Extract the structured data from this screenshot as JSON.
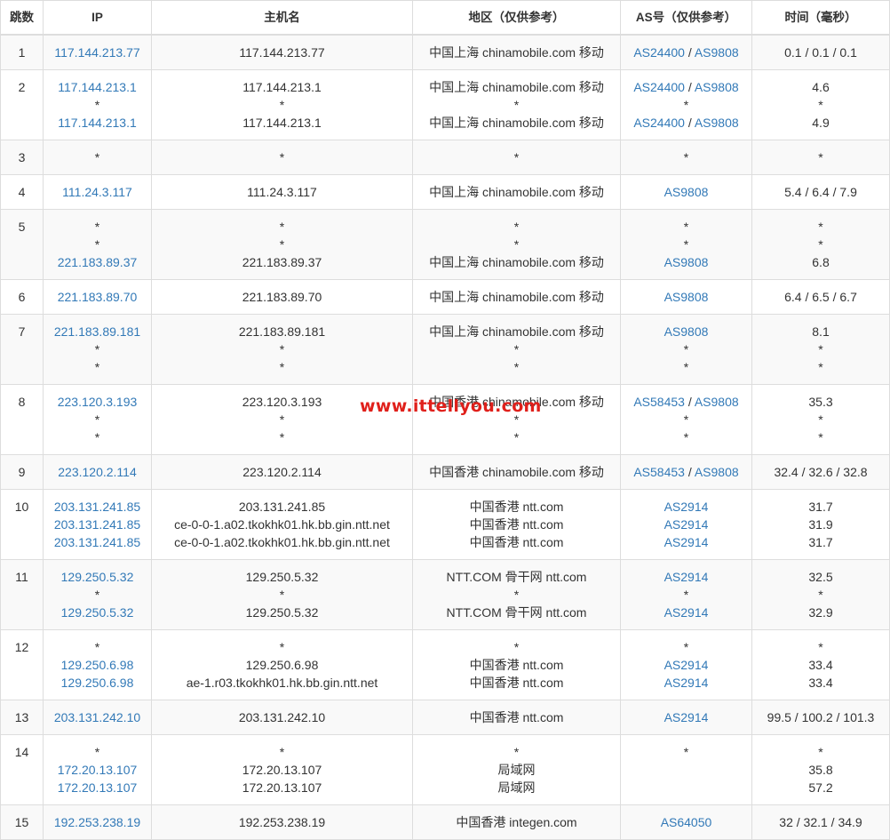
{
  "headers": [
    "跳数",
    "IP",
    "主机名",
    "地区（仅供参考）",
    "AS号（仅供参考）",
    "时间（毫秒）"
  ],
  "watermark": "www.ittellyou.com",
  "rows": [
    {
      "hop": "1",
      "ip": [
        "117.144.213.77"
      ],
      "host": [
        "117.144.213.77"
      ],
      "region": [
        "中国上海 chinamobile.com 移动"
      ],
      "as": [
        [
          "AS24400",
          "AS9808"
        ]
      ],
      "time": [
        "0.1 / 0.1 / 0.1"
      ]
    },
    {
      "hop": "2",
      "ip": [
        "117.144.213.1",
        "*",
        "117.144.213.1"
      ],
      "host": [
        "117.144.213.1",
        "*",
        "117.144.213.1"
      ],
      "region": [
        "中国上海 chinamobile.com 移动",
        "*",
        "中国上海 chinamobile.com 移动"
      ],
      "as": [
        [
          "AS24400",
          "AS9808"
        ],
        [
          "*"
        ],
        [
          "AS24400",
          "AS9808"
        ]
      ],
      "time": [
        "4.6",
        "*",
        "4.9"
      ]
    },
    {
      "hop": "3",
      "ip": [
        "*"
      ],
      "host": [
        "*"
      ],
      "region": [
        "*"
      ],
      "as": [
        [
          "*"
        ]
      ],
      "time": [
        "*"
      ]
    },
    {
      "hop": "4",
      "ip": [
        "111.24.3.117"
      ],
      "host": [
        "111.24.3.117"
      ],
      "region": [
        "中国上海 chinamobile.com 移动"
      ],
      "as": [
        [
          "AS9808"
        ]
      ],
      "time": [
        "5.4 / 6.4 / 7.9"
      ]
    },
    {
      "hop": "5",
      "ip": [
        "*",
        "*",
        "221.183.89.37"
      ],
      "host": [
        "*",
        "*",
        "221.183.89.37"
      ],
      "region": [
        "*",
        "*",
        "中国上海 chinamobile.com 移动"
      ],
      "as": [
        [
          "*"
        ],
        [
          "*"
        ],
        [
          "AS9808"
        ]
      ],
      "time": [
        "*",
        "*",
        "6.8"
      ]
    },
    {
      "hop": "6",
      "ip": [
        "221.183.89.70"
      ],
      "host": [
        "221.183.89.70"
      ],
      "region": [
        "中国上海 chinamobile.com 移动"
      ],
      "as": [
        [
          "AS9808"
        ]
      ],
      "time": [
        "6.4 / 6.5 / 6.7"
      ]
    },
    {
      "hop": "7",
      "ip": [
        "221.183.89.181",
        "*",
        "*"
      ],
      "host": [
        "221.183.89.181",
        "*",
        "*"
      ],
      "region": [
        "中国上海 chinamobile.com 移动",
        "*",
        "*"
      ],
      "as": [
        [
          "AS9808"
        ],
        [
          "*"
        ],
        [
          "*"
        ]
      ],
      "time": [
        "8.1",
        "*",
        "*"
      ]
    },
    {
      "hop": "8",
      "ip": [
        "223.120.3.193",
        "*",
        "*"
      ],
      "host": [
        "223.120.3.193",
        "*",
        "*"
      ],
      "region": [
        "中国香港 chinamobile.com 移动",
        "*",
        "*"
      ],
      "as": [
        [
          "AS58453",
          "AS9808"
        ],
        [
          "*"
        ],
        [
          "*"
        ]
      ],
      "time": [
        "35.3",
        "*",
        "*"
      ]
    },
    {
      "hop": "9",
      "ip": [
        "223.120.2.114"
      ],
      "host": [
        "223.120.2.114"
      ],
      "region": [
        "中国香港 chinamobile.com 移动"
      ],
      "as": [
        [
          "AS58453",
          "AS9808"
        ]
      ],
      "time": [
        "32.4 / 32.6 / 32.8"
      ]
    },
    {
      "hop": "10",
      "ip": [
        "203.131.241.85",
        "203.131.241.85",
        "203.131.241.85"
      ],
      "host": [
        "203.131.241.85",
        "ce-0-0-1.a02.tkokhk01.hk.bb.gin.ntt.net",
        "ce-0-0-1.a02.tkokhk01.hk.bb.gin.ntt.net"
      ],
      "region": [
        "中国香港 ntt.com",
        "中国香港 ntt.com",
        "中国香港 ntt.com"
      ],
      "as": [
        [
          "AS2914"
        ],
        [
          "AS2914"
        ],
        [
          "AS2914"
        ]
      ],
      "time": [
        "31.7",
        "31.9",
        "31.7"
      ]
    },
    {
      "hop": "11",
      "ip": [
        "129.250.5.32",
        "*",
        "129.250.5.32"
      ],
      "host": [
        "129.250.5.32",
        "*",
        "129.250.5.32"
      ],
      "region": [
        "NTT.COM 骨干网 ntt.com",
        "*",
        "NTT.COM 骨干网 ntt.com"
      ],
      "as": [
        [
          "AS2914"
        ],
        [
          "*"
        ],
        [
          "AS2914"
        ]
      ],
      "time": [
        "32.5",
        "*",
        "32.9"
      ]
    },
    {
      "hop": "12",
      "ip": [
        "*",
        "129.250.6.98",
        "129.250.6.98"
      ],
      "host": [
        "*",
        "129.250.6.98",
        "ae-1.r03.tkokhk01.hk.bb.gin.ntt.net"
      ],
      "region": [
        "*",
        "中国香港 ntt.com",
        "中国香港 ntt.com"
      ],
      "as": [
        [
          "*"
        ],
        [
          "AS2914"
        ],
        [
          "AS2914"
        ]
      ],
      "time": [
        "*",
        "33.4",
        "33.4"
      ]
    },
    {
      "hop": "13",
      "ip": [
        "203.131.242.10"
      ],
      "host": [
        "203.131.242.10"
      ],
      "region": [
        "中国香港 ntt.com"
      ],
      "as": [
        [
          "AS2914"
        ]
      ],
      "time": [
        "99.5 / 100.2 / 101.3"
      ]
    },
    {
      "hop": "14",
      "ip": [
        "*",
        "172.20.13.107",
        "172.20.13.107"
      ],
      "host": [
        "*",
        "172.20.13.107",
        "172.20.13.107"
      ],
      "region": [
        "*",
        "局域网",
        "局域网"
      ],
      "as": [
        [
          "*"
        ],
        [
          ""
        ],
        [
          ""
        ]
      ],
      "time": [
        "*",
        "35.8",
        "57.2"
      ]
    },
    {
      "hop": "15",
      "ip": [
        "192.253.238.19"
      ],
      "host": [
        "192.253.238.19"
      ],
      "region": [
        "中国香港 integen.com"
      ],
      "as": [
        [
          "AS64050"
        ]
      ],
      "time": [
        "32 / 32.1 / 34.9"
      ]
    }
  ]
}
